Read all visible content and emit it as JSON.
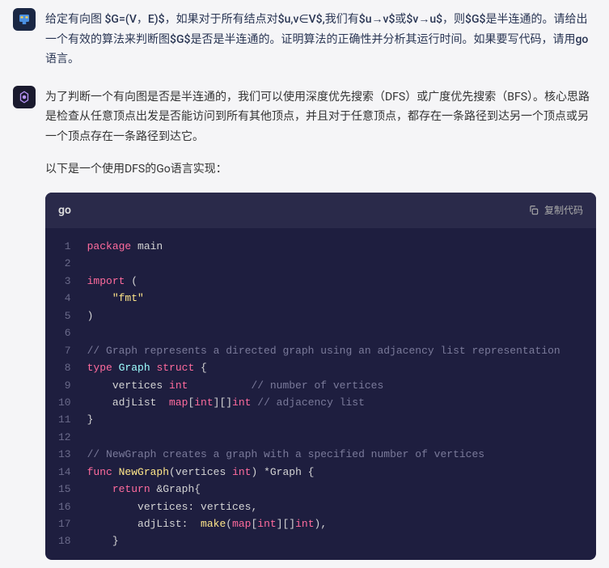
{
  "user_message": "给定有向图 $G=(V，E)$，如果对于所有结点对$u,v∈V$,我们有$u→v$或$v→u$，则$G$是半连通的。请给出一个有效的算法来判断图$G$是否是半连通的。证明算法的正确性并分析其运行时间。如果要写代码，请用go语言。",
  "ai_message": {
    "p1": "为了判断一个有向图是否是半连通的，我们可以使用深度优先搜索（DFS）或广度优先搜索（BFS）。核心思路是检查从任意顶点出发是否能访问到所有其他顶点，并且对于任意顶点，都存在一条路径到达另一个顶点或另一个顶点存在一条路径到达它。",
    "p2": "以下是一个使用DFS的Go语言实现："
  },
  "code": {
    "lang": "go",
    "copy_label": "复制代码",
    "lines": [
      {
        "n": 1,
        "tokens": [
          {
            "t": "package ",
            "c": "kw"
          },
          {
            "t": "main",
            "c": "id"
          }
        ]
      },
      {
        "n": 2,
        "tokens": []
      },
      {
        "n": 3,
        "tokens": [
          {
            "t": "import ",
            "c": "kw"
          },
          {
            "t": "(",
            "c": "id"
          }
        ]
      },
      {
        "n": 4,
        "tokens": [
          {
            "t": "    \"fmt\"",
            "c": "str"
          }
        ]
      },
      {
        "n": 5,
        "tokens": [
          {
            "t": ")",
            "c": "id"
          }
        ]
      },
      {
        "n": 6,
        "tokens": []
      },
      {
        "n": 7,
        "tokens": [
          {
            "t": "// Graph represents a directed graph using an adjacency list representation",
            "c": "cmt"
          }
        ]
      },
      {
        "n": 8,
        "tokens": [
          {
            "t": "type ",
            "c": "kw"
          },
          {
            "t": "Graph ",
            "c": "typ"
          },
          {
            "t": "struct ",
            "c": "kw"
          },
          {
            "t": "{",
            "c": "id"
          }
        ]
      },
      {
        "n": 9,
        "tokens": [
          {
            "t": "    vertices ",
            "c": "id"
          },
          {
            "t": "int",
            "c": "kw"
          },
          {
            "t": "          ",
            "c": "id"
          },
          {
            "t": "// number of vertices",
            "c": "cmt"
          }
        ]
      },
      {
        "n": 10,
        "tokens": [
          {
            "t": "    adjList  ",
            "c": "id"
          },
          {
            "t": "map",
            "c": "kw"
          },
          {
            "t": "[",
            "c": "id"
          },
          {
            "t": "int",
            "c": "kw"
          },
          {
            "t": "][]",
            "c": "id"
          },
          {
            "t": "int ",
            "c": "kw"
          },
          {
            "t": "// adjacency list",
            "c": "cmt"
          }
        ]
      },
      {
        "n": 11,
        "tokens": [
          {
            "t": "}",
            "c": "id"
          }
        ]
      },
      {
        "n": 12,
        "tokens": []
      },
      {
        "n": 13,
        "tokens": [
          {
            "t": "// NewGraph creates a graph with a specified number of vertices",
            "c": "cmt"
          }
        ]
      },
      {
        "n": 14,
        "tokens": [
          {
            "t": "func ",
            "c": "kw"
          },
          {
            "t": "NewGraph",
            "c": "fn"
          },
          {
            "t": "(vertices ",
            "c": "id"
          },
          {
            "t": "int",
            "c": "kw"
          },
          {
            "t": ") *Graph {",
            "c": "id"
          }
        ]
      },
      {
        "n": 15,
        "tokens": [
          {
            "t": "    ",
            "c": "id"
          },
          {
            "t": "return ",
            "c": "kw"
          },
          {
            "t": "&Graph{",
            "c": "id"
          }
        ]
      },
      {
        "n": 16,
        "tokens": [
          {
            "t": "        vertices: vertices,",
            "c": "id"
          }
        ]
      },
      {
        "n": 17,
        "tokens": [
          {
            "t": "        adjList:  ",
            "c": "id"
          },
          {
            "t": "make",
            "c": "fn"
          },
          {
            "t": "(",
            "c": "id"
          },
          {
            "t": "map",
            "c": "kw"
          },
          {
            "t": "[",
            "c": "id"
          },
          {
            "t": "int",
            "c": "kw"
          },
          {
            "t": "][]",
            "c": "id"
          },
          {
            "t": "int",
            "c": "kw"
          },
          {
            "t": "),",
            "c": "id"
          }
        ]
      },
      {
        "n": 18,
        "tokens": [
          {
            "t": "    }",
            "c": "id"
          }
        ]
      }
    ]
  }
}
